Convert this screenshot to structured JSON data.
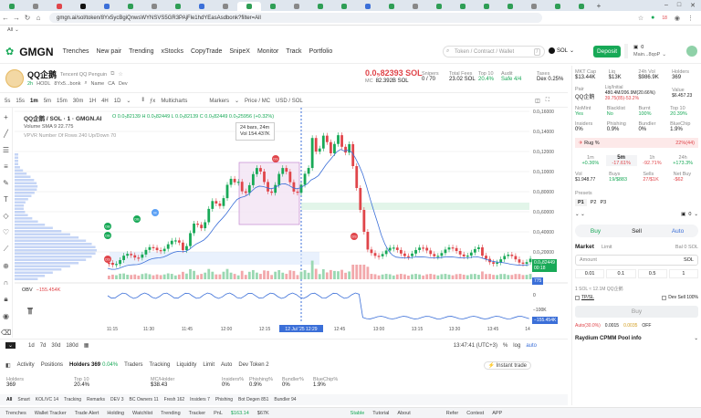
{
  "browser": {
    "url": "gmgn.ai/sol/token/8Yx5ycBgiQnwsWYNSVS5GR3PAjFle1hdYEasAsdbonk?filter=All",
    "bookmark_label": "All",
    "tab_count_label": "18"
  },
  "app": {
    "logo_text": "GMGN",
    "nav": [
      "Trenches",
      "New pair",
      "Trending",
      "xStocks",
      "CopyTrade",
      "SnipeX",
      "Monitor",
      "Track",
      "Portfolio"
    ],
    "search_placeholder": "Token / Contract / Wallet",
    "search_shortcut": "/",
    "chain": "SOL",
    "deposit_label": "Deposit",
    "balance": "0",
    "wallet_short": "Main...8qoP"
  },
  "token": {
    "symbol": "QQ企鹅",
    "full_name": "Tencent QQ Penguin",
    "age": "2h",
    "holders_tag": "HODL",
    "address_short": "8Yx5...bonk",
    "links": [
      "Name",
      "CA",
      "Dev"
    ],
    "price": "0.0₅82393 SOL",
    "mc_label": "MC",
    "mc": "82.392B SOL",
    "stats": [
      {
        "label": "Snipers",
        "value": "0 / 70"
      },
      {
        "label": "Total Fees",
        "value": "23.02 SOL"
      },
      {
        "label": "Top 10",
        "value": "20.4%"
      },
      {
        "label": "Audit",
        "value": "Safe 4/4"
      },
      {
        "label": "Taxes",
        "value": "Dex 0.25%"
      }
    ]
  },
  "chart_toolbar": {
    "intervals": [
      "5s",
      "15s",
      "1m",
      "5m",
      "15m",
      "30m",
      "1H",
      "4H",
      "1D"
    ],
    "active_interval": "1m",
    "tools": [
      "Multicharts",
      "Markers",
      "Price / MC",
      "USD / SOL"
    ]
  },
  "chart_legend": {
    "title": "QQ企鹅 / SOL · 1 · GMGN.AI",
    "ohlc": "O 0.0₅82139  H 0.0₅82449  L 0.0₅82139  C 0.0₅82449  0.0₅25956 (+0.32%)",
    "volume": "Volume SMA 9  22.775",
    "vpvr": "VPVR Number Of Rows 240 Up/Down 70",
    "tooltip_1": "24 bars, 24m",
    "tooltip_2": "Vol 154.437K",
    "obv_label": "OBV",
    "obv_value": "−155.454K",
    "obv_right": "−155.454K",
    "obv_axis": [
      "0",
      "−100K"
    ],
    "current_price_label": "0.0₅82449",
    "current_price_time": "00:18",
    "volume_axis_label": "775"
  },
  "chart_data": {
    "type": "candlestick",
    "y_ticks": [
      "0.0₅16000",
      "0.0₅14000",
      "0.0₅12000",
      "0.0₅10000",
      "0.0₅80000",
      "0.0₅60000",
      "0.0₅40000",
      "0.0₅20000"
    ],
    "x_ticks": [
      "11:15",
      "11:30",
      "11:45",
      "12:00",
      "12:15",
      "12 Jul '25  12:29",
      "12:45",
      "13:00",
      "13:15",
      "13:30",
      "13:45",
      "14"
    ],
    "markers": [
      "DB",
      "DB",
      "DS",
      "DB",
      "M",
      "DS",
      "DS"
    ]
  },
  "chart_bottom": {
    "ranges": [
      "1d",
      "7d",
      "30d",
      "180d"
    ],
    "time": "13:47:41 (UTC+3)",
    "scale": [
      "%",
      "log",
      "auto"
    ]
  },
  "activity_tabs": [
    "Activity",
    "Positions",
    "Holders 369",
    "Traders",
    "Tracking",
    "Liquidity",
    "Limit",
    "Auto",
    "Dev Token 2"
  ],
  "activity_extra": {
    "holders_pct": "0.04%",
    "instant_trade": "Instant trade"
  },
  "holder_stats": [
    {
      "label": "Holders",
      "value": "369"
    },
    {
      "label": "Top 10",
      "value": "20.4%"
    },
    {
      "label": "MC/Holder",
      "value": "$38.43"
    },
    {
      "label": "Insiders%",
      "value": "0%"
    },
    {
      "label": "Phishing%",
      "value": "0.9%"
    },
    {
      "label": "Bundler%",
      "value": "0%"
    },
    {
      "label": "BlueChip%",
      "value": "1.9%"
    }
  ],
  "filters": [
    "All",
    "Smart",
    "KOL/VC 14",
    "Tracking",
    "Remarks",
    "DEV 3",
    "BC Owners 11",
    "Fresh 162",
    "Insiders 7",
    "Phishing",
    "Bot Degen 851",
    "Bundler 94"
  ],
  "footer": [
    "Trenches",
    "Wallet Tracker",
    "Trade Alert",
    "Holding",
    "Watchlist",
    "Trending",
    "Tracker",
    "PnL",
    "$163.14",
    "$67K",
    "Stable",
    "Tutorial",
    "About",
    "Refer",
    "Contest",
    "APP"
  ],
  "right": {
    "mkt": [
      {
        "label": "MKT Cap",
        "value": "$13.44K"
      },
      {
        "label": "Liq",
        "value": "$13K"
      },
      {
        "label": "24h Vol",
        "value": "$986.9K"
      },
      {
        "label": "Holders",
        "value": "369"
      }
    ],
    "pair": [
      {
        "label": "Pair",
        "value": "QQ企鹅"
      },
      {
        "label": "Liq/Initial",
        "value": "480.4M/206.9M(20.66%)"
      },
      {
        "label": "",
        "value": "39.75(85)-53.2%"
      },
      {
        "label": "Value",
        "value": "$6.457.23"
      }
    ],
    "checks": [
      {
        "label": "NoMint",
        "value": "Yes"
      },
      {
        "label": "Blacklist",
        "value": "No"
      },
      {
        "label": "Burnt",
        "value": "100%"
      },
      {
        "label": "Top 10",
        "value": "20.39%"
      }
    ],
    "checks2": [
      {
        "label": "Insiders",
        "value": "0%"
      },
      {
        "label": "Phishing",
        "value": "0.9%"
      },
      {
        "label": "Bundler",
        "value": "0%"
      },
      {
        "label": "BlueChip",
        "value": "1.9%"
      }
    ],
    "rug_label": "Rug %",
    "rug_value": "22%(44)",
    "periods": [
      {
        "label": "1m",
        "value": "+0.36%"
      },
      {
        "label": "5m",
        "value": "-17.61%"
      },
      {
        "label": "1h",
        "value": "-92.71%"
      },
      {
        "label": "24h",
        "value": "+173.3%"
      }
    ],
    "vol": [
      {
        "label": "Vol",
        "value": "$1.948.77"
      },
      {
        "label": "Buys",
        "value": "19/$883"
      },
      {
        "label": "Sells",
        "value": "27/$1K"
      },
      {
        "label": "Net Buy",
        "value": "-$62"
      }
    ],
    "presets_label": "Presets",
    "presets": [
      "P1",
      "P2",
      "P3"
    ],
    "amount_value": "0",
    "buy": "Buy",
    "sell": "Sell",
    "auto": "Auto",
    "market": "Market",
    "limit": "Limit",
    "balance": "Bal 0 SOL",
    "amount_placeholder": "Amount",
    "amount_unit": "SOL",
    "quick": [
      "0.01",
      "0.1",
      "0.5",
      "1"
    ],
    "rate": "1 SOL ≈ 12.1M QQ企鹅",
    "tpsl": "TP/SL",
    "dev_sell": "Dev Sell 100%",
    "buy_btn": "Buy",
    "fees": [
      "Auto(30.0%)",
      "0.0015",
      "0.0035",
      "OFF"
    ],
    "pool_info": "Raydium CPMM Pool info"
  }
}
